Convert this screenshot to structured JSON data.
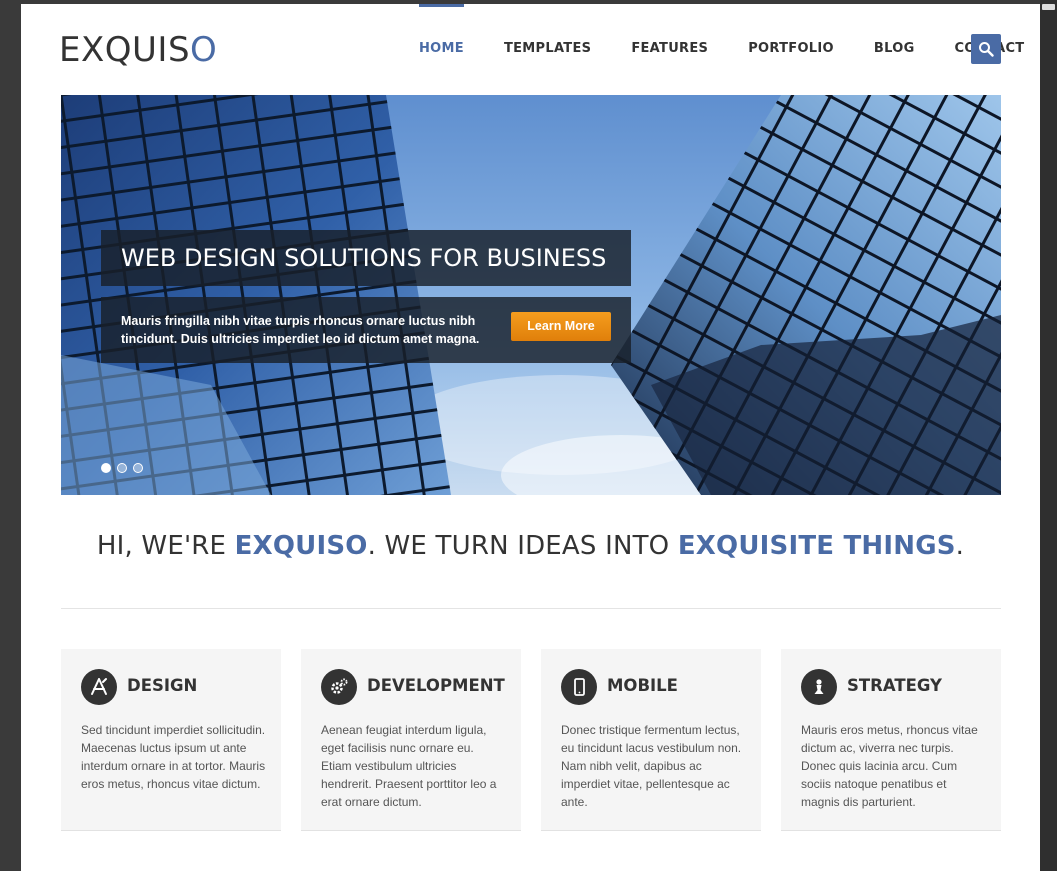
{
  "brand": {
    "logo_main": "EXQUIS",
    "logo_accent": "O"
  },
  "nav": {
    "items": [
      {
        "label": "HOME",
        "active": true
      },
      {
        "label": "TEMPLATES"
      },
      {
        "label": "FEATURES"
      },
      {
        "label": "PORTFOLIO"
      },
      {
        "label": "BLOG"
      },
      {
        "label": "CONTACT"
      }
    ],
    "search_icon": "search-icon"
  },
  "hero": {
    "title": "WEB DESIGN SOLUTIONS FOR BUSINESS",
    "text": "Mauris fringilla nibh vitae turpis rhoncus ornare luctus nibh tincidunt. Duis ultricies imperdiet leo id dictum amet magna.",
    "button": "Learn More",
    "slides": 3,
    "active_slide": 1
  },
  "tagline": {
    "prefix": "HI, WE'RE ",
    "brand": "EXQUISO",
    "middle": ". WE TURN IDEAS INTO ",
    "highlight": "EXQUISITE THINGS",
    "suffix": "."
  },
  "features": [
    {
      "icon": "app-store-icon",
      "title": "DESIGN",
      "text": "Sed tincidunt imperdiet sollicitudin. Maecenas luctus ipsum ut ante interdum ornare in at tortor. Mauris eros metus, rhoncus vitae dictum."
    },
    {
      "icon": "gears-icon",
      "title": "DEVELOPMENT",
      "text": "Aenean feugiat interdum ligula, eget facilisis nunc ornare eu. Etiam vestibulum ultricies hendrerit. Praesent porttitor leo a erat ornare dictum."
    },
    {
      "icon": "mobile-phone-icon",
      "title": "MOBILE",
      "text": "Donec tristique fermentum lectus, eu tincidunt lacus vestibulum non. Nam nibh velit, dapibus ac imperdiet vitae, pellentesque ac ante."
    },
    {
      "icon": "chess-pawn-icon",
      "title": "STRATEGY",
      "text": "Mauris eros metus, rhoncus vitae dictum ac, viverra nec turpis. Donec quis lacinia arcu. Cum sociis natoque penatibus et magnis dis parturient."
    }
  ],
  "colors": {
    "accent": "#4a6ba5",
    "button": "#ef8c12",
    "text": "#333333",
    "background": "#3a3a3a"
  }
}
